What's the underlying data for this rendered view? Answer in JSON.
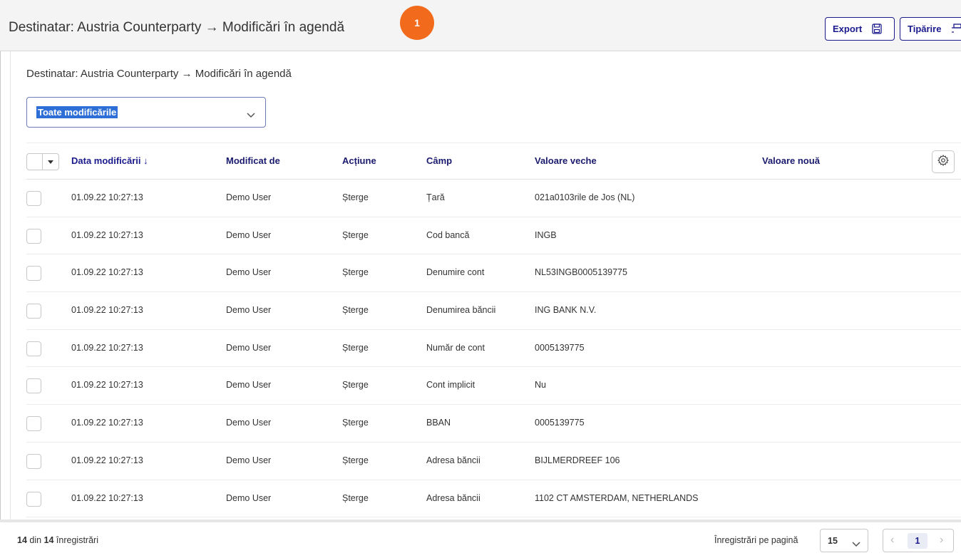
{
  "header": {
    "title": "Destinatar: Austria Counterparty → Modificări în agendă",
    "step_badge": "1",
    "export_label": "Export",
    "print_label": "Tipărire"
  },
  "panel": {
    "title": "Destinatar: Austria Counterparty → Modificări în agendă",
    "filter": {
      "selected": "Toate modificările"
    }
  },
  "table": {
    "columns": [
      "Data modificării ↓",
      "Modificat de",
      "Acțiune",
      "Câmp",
      "Valoare veche",
      "Valoare nouă"
    ],
    "rows": [
      {
        "date": "01.09.22 10:27:13",
        "user": "Demo User",
        "action": "Șterge",
        "field": "Țară",
        "old": "021a0103rile de Jos (NL)",
        "new": ""
      },
      {
        "date": "01.09.22 10:27:13",
        "user": "Demo User",
        "action": "Șterge",
        "field": "Cod bancă",
        "old": "INGB",
        "new": ""
      },
      {
        "date": "01.09.22 10:27:13",
        "user": "Demo User",
        "action": "Șterge",
        "field": "Denumire cont",
        "old": "NL53INGB0005139775",
        "new": ""
      },
      {
        "date": "01.09.22 10:27:13",
        "user": "Demo User",
        "action": "Șterge",
        "field": "Denumirea băncii",
        "old": "ING BANK N.V.",
        "new": ""
      },
      {
        "date": "01.09.22 10:27:13",
        "user": "Demo User",
        "action": "Șterge",
        "field": "Număr de cont",
        "old": "0005139775",
        "new": ""
      },
      {
        "date": "01.09.22 10:27:13",
        "user": "Demo User",
        "action": "Șterge",
        "field": "Cont implicit",
        "old": "Nu",
        "new": ""
      },
      {
        "date": "01.09.22 10:27:13",
        "user": "Demo User",
        "action": "Șterge",
        "field": "BBAN",
        "old": "0005139775",
        "new": ""
      },
      {
        "date": "01.09.22 10:27:13",
        "user": "Demo User",
        "action": "Șterge",
        "field": "Adresa băncii",
        "old": "BIJLMERDREEF 106",
        "new": ""
      },
      {
        "date": "01.09.22 10:27:13",
        "user": "Demo User",
        "action": "Șterge",
        "field": "Adresa băncii",
        "old": "1102 CT AMSTERDAM, NETHERLANDS",
        "new": ""
      }
    ]
  },
  "footer": {
    "count_shown": "14",
    "count_sep": " din ",
    "count_total": "14",
    "count_suffix": " înregistrări",
    "per_page_label": "Înregistrări pe pagină",
    "per_page_value": "15",
    "current_page": "1"
  },
  "colors": {
    "accent": "#1a1a8c",
    "badge": "#f26b1d",
    "selection": "#2d6fd6"
  }
}
